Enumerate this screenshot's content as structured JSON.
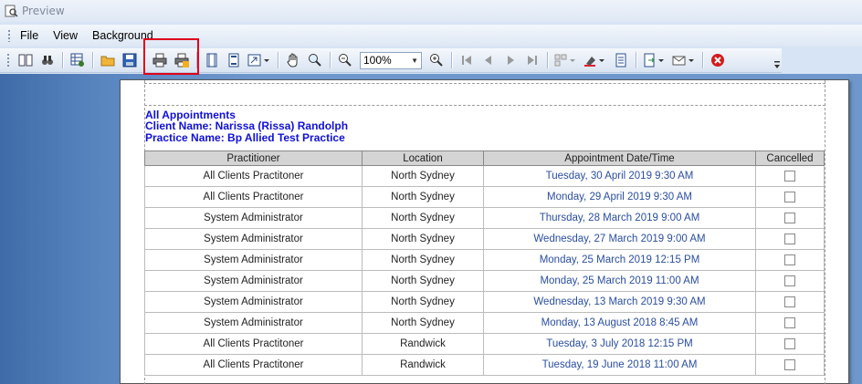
{
  "window": {
    "title": "Preview"
  },
  "menu": {
    "items": [
      "File",
      "View",
      "Background"
    ]
  },
  "toolbar": {
    "zoom_value": "100%",
    "buttons": [
      "parameters-icon",
      "search-icon",
      "customize-icon",
      "open-icon",
      "save-icon",
      "print-icon",
      "quick-print-icon",
      "page-setup-icon",
      "header-footer-icon",
      "scale-icon",
      "hand-tool-icon",
      "magnifier-icon",
      "zoom-out-icon",
      "zoom-in-icon",
      "first-page-icon",
      "previous-page-icon",
      "next-page-icon",
      "last-page-icon",
      "multiple-pages-icon",
      "color-icon",
      "watermark-icon",
      "export-icon",
      "send-email-icon",
      "close-preview-icon"
    ]
  },
  "report": {
    "title": "All Appointments",
    "client_line": "Client Name: Narissa (Rissa) Randolph",
    "practice_line": "Practice Name: Bp Allied Test Practice",
    "columns": [
      "Practitioner",
      "Location",
      "Appointment Date/Time",
      "Cancelled"
    ],
    "rows": [
      {
        "practitioner": "All Clients Practitoner",
        "location": "North Sydney",
        "datetime": "Tuesday, 30 April 2019 9:30 AM",
        "cancelled": false
      },
      {
        "practitioner": "All Clients Practitoner",
        "location": "North Sydney",
        "datetime": "Monday, 29 April 2019 9:30 AM",
        "cancelled": false
      },
      {
        "practitioner": "System Administrator",
        "location": "North Sydney",
        "datetime": "Thursday, 28 March 2019 9:00 AM",
        "cancelled": false
      },
      {
        "practitioner": "System Administrator",
        "location": "North Sydney",
        "datetime": "Wednesday, 27 March 2019 9:00 AM",
        "cancelled": false
      },
      {
        "practitioner": "System Administrator",
        "location": "North Sydney",
        "datetime": "Monday, 25 March 2019 12:15 PM",
        "cancelled": false
      },
      {
        "practitioner": "System Administrator",
        "location": "North Sydney",
        "datetime": "Monday, 25 March 2019 11:00 AM",
        "cancelled": false
      },
      {
        "practitioner": "System Administrator",
        "location": "North Sydney",
        "datetime": "Wednesday, 13 March 2019 9:30 AM",
        "cancelled": false
      },
      {
        "practitioner": "System Administrator",
        "location": "North Sydney",
        "datetime": "Monday, 13 August 2018 8:45 AM",
        "cancelled": false
      },
      {
        "practitioner": "All Clients Practitoner",
        "location": "Randwick",
        "datetime": "Tuesday, 3 July 2018 12:15 PM",
        "cancelled": false
      },
      {
        "practitioner": "All Clients Practitoner",
        "location": "Randwick",
        "datetime": "Tuesday, 19 June 2018 11:00 AM",
        "cancelled": false
      }
    ]
  },
  "colors": {
    "header_text": "#1010d8",
    "datetime_text": "#2a4ea0",
    "highlight": "#e0001b"
  }
}
